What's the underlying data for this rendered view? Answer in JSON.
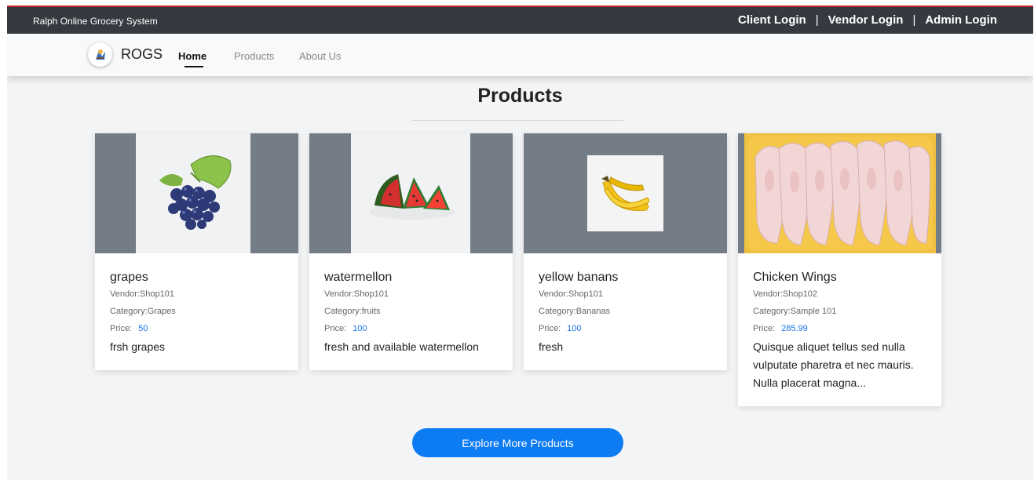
{
  "topbar": {
    "site_name": "Ralph Online Grocery System",
    "client_login": "Client Login",
    "vendor_login": "Vendor Login",
    "admin_login": "Admin Login",
    "separator": "|"
  },
  "navbar": {
    "brand": "ROGS",
    "items": [
      {
        "label": "Home",
        "active": true
      },
      {
        "label": "Products",
        "active": false
      },
      {
        "label": "About Us",
        "active": false
      }
    ]
  },
  "section": {
    "title": "Products"
  },
  "products": [
    {
      "name": "grapes",
      "vendor": "Vendor:Shop101",
      "category": "Category:Grapes",
      "price_label": "Price:",
      "price": "50",
      "description": "frsh grapes",
      "image_icon": "grapes-image"
    },
    {
      "name": "watermellon",
      "vendor": "Vendor:Shop101",
      "category": "Category:fruits",
      "price_label": "Price:",
      "price": "100",
      "description": "fresh and available watermellon",
      "image_icon": "watermelon-image"
    },
    {
      "name": "yellow banans",
      "vendor": "Vendor:Shop101",
      "category": "Category:Bananas",
      "price_label": "Price:",
      "price": "100",
      "description": "fresh",
      "image_icon": "banana-image"
    },
    {
      "name": "Chicken Wings",
      "vendor": "Vendor:Shop102",
      "category": "Category:Sample 101",
      "price_label": "Price:",
      "price": "285.99",
      "description": "Quisque aliquet tellus sed nulla vulputate pharetra et nec mauris. Nulla placerat magna...",
      "image_icon": "chicken-wings-image"
    }
  ],
  "cta": {
    "label": "Explore More Products"
  },
  "colors": {
    "topbar_bg": "#343a40",
    "accent": "#0d7bf2",
    "price_color": "#1a73e8",
    "image_bg": "#747d87"
  }
}
